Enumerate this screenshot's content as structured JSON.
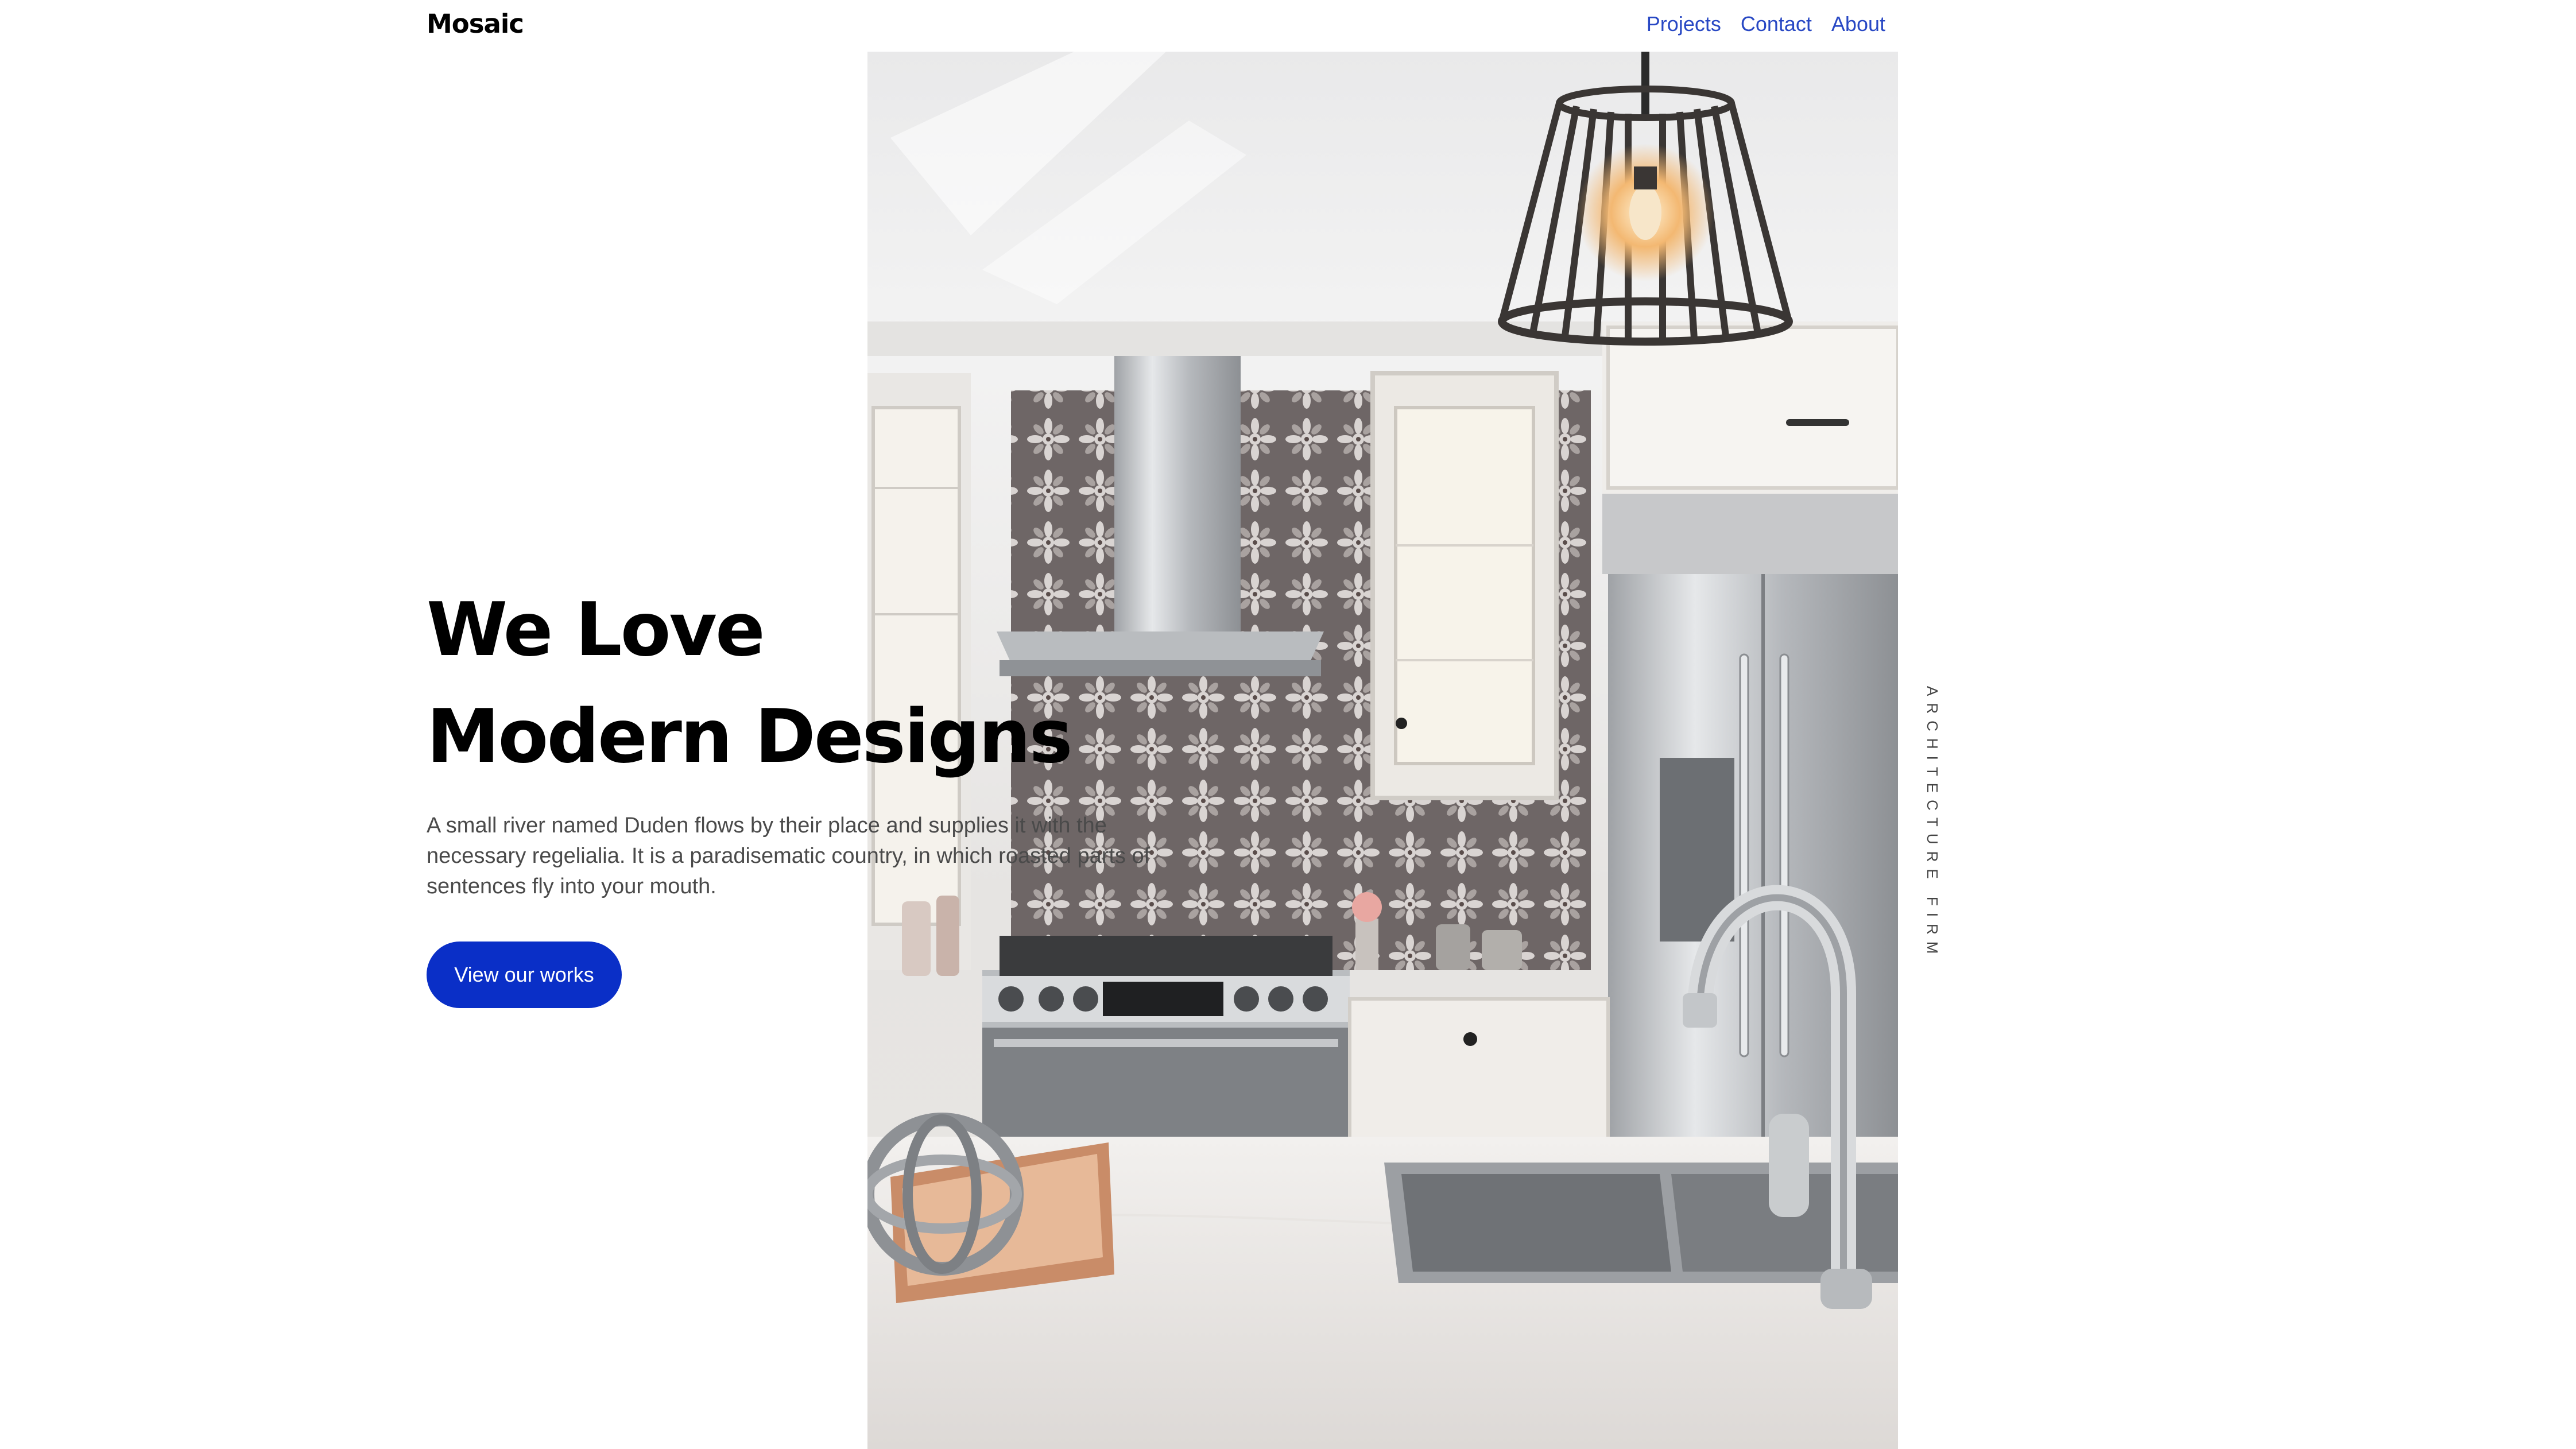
{
  "brand": {
    "name": "Mosaic"
  },
  "nav": {
    "items": [
      {
        "label": "Projects"
      },
      {
        "label": "Contact"
      },
      {
        "label": "About"
      }
    ],
    "link_color": "#2848c4"
  },
  "hero": {
    "title_line_1": "We Love",
    "title_line_2": "Modern Designs",
    "description": "A small river named Duden flows by their place and supplies it with the necessary regelialia. It is a paradisematic country, in which roasted parts of sentences fly into your mouth.",
    "cta_label": "View our works",
    "cta_color": "#0a2fc7",
    "image_icon": "kitchen-photo"
  },
  "side_label": {
    "text": "ARCHITECTURE FIRM"
  }
}
